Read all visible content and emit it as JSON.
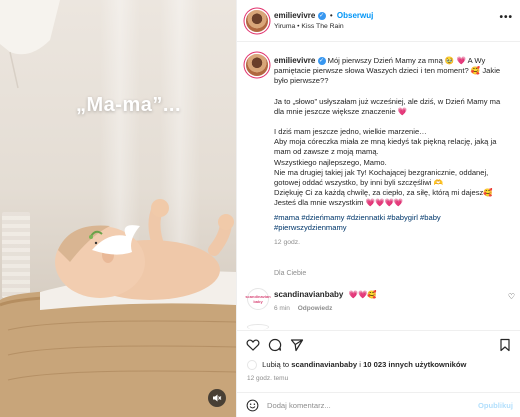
{
  "media": {
    "overlay_text": "„Ma-ma”...",
    "mute_icon": "speaker-muted-icon"
  },
  "header": {
    "username": "emilievivre",
    "separator": "•",
    "follow_label": "Obserwuj",
    "audio": "Yiruma • Kiss The Rain",
    "more_label": "•••"
  },
  "caption": {
    "username": "emilievivre",
    "lines": [
      "Mój pierwszy Dzień Mamy za mną 🥹 💗 A Wy pamiętacie pierwsze słowa Waszych dzieci i ten moment? 🥰 Jakie było pierwsze??",
      "",
      "Ja to „słowo” usłyszałam już wcześniej, ale dziś, w Dzień Mamy ma dla mnie jeszcze większe znaczenie 💗",
      "",
      "I dziś mam jeszcze jedno, wielkie marzenie…",
      "Aby moja córeczka miała ze mną kiedyś tak piękną relację, jaką ja mam od zawsze z moją mamą.",
      "Wszystkiego najlepszego, Mamo.",
      "Nie ma drugiej takiej jak Ty! Kochającej bezgranicznie, oddanej, gotowej oddać wszystko, by inni byli szczęśliwi 🫶",
      "Dziękuję Ci za każdą chwilę, za ciepło, za siłę, którą mi dajesz🥰 Jesteś dla mnie wszystkim 💗💗💗💗"
    ],
    "hashtags": "#mama #dzieńmamy #dziennatki #babygirl #baby #pierwszydzienmamy",
    "time": "12 godz.",
    "for_you": "Dla Ciebie"
  },
  "comments": [
    {
      "username": "scandinavianbaby",
      "avatar_text": "scandinavian baby",
      "text": "💗💗🥰",
      "time": "6 min",
      "reply_label": "Odpowiedz"
    }
  ],
  "actions": {
    "like_icon": "heart-icon",
    "comment_icon": "comment-icon",
    "share_icon": "share-icon",
    "save_icon": "bookmark-icon"
  },
  "likes": {
    "prefix": "Lubią to",
    "first_user": "scandinavianbaby",
    "middle": "i",
    "count": "10 023 innych użytkowników"
  },
  "posted_time": "12 godz. temu",
  "comment_box": {
    "placeholder": "Dodaj komentarz...",
    "publish_label": "Opublikuj"
  },
  "colors": {
    "accent": "#0095f6",
    "heart_pink": "#e1306c",
    "hashtag": "#00376b",
    "muted": "#8e8e8e"
  }
}
